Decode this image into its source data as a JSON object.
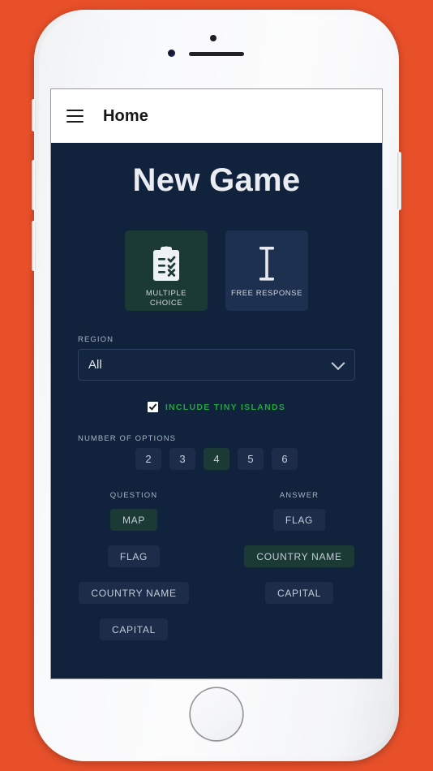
{
  "background_color": "#e8502a",
  "device": {
    "name": "white-smartphone-frame",
    "hardware": {
      "earpiece": "earpiece-speaker",
      "front_camera": "front-camera",
      "proximity_sensor": "proximity-sensor",
      "home_button": "home-button",
      "buttons": [
        "silent-switch",
        "volume-up-button",
        "volume-down-button",
        "power-button"
      ]
    }
  },
  "app_bar": {
    "menu_icon": "hamburger-menu-icon",
    "title": "Home",
    "background": "#ffffff",
    "text_color": "#161618"
  },
  "screen": {
    "background": "#11223d",
    "title": "New Game"
  },
  "mode_cards": [
    {
      "label_line1": "MULTIPLE",
      "label_line2": "CHOICE",
      "icon": "clipboard-checklist-icon",
      "selected": true,
      "color": "#1c3a35"
    },
    {
      "label_line1": "FREE RESPONSE",
      "label_line2": "",
      "icon": "text-cursor-i-beam-icon",
      "selected": false,
      "color": "#1e3050"
    }
  ],
  "region": {
    "label": "REGION",
    "value": "All",
    "chevron_icon": "chevron-down-icon"
  },
  "tiny_islands": {
    "label": "INCLUDE TINY ISLANDS",
    "checked": true,
    "color": "#22a53f",
    "checkbox_icon": "checkbox-checked-icon"
  },
  "number_of_options": {
    "label": "NUMBER OF OPTIONS",
    "options": [
      "2",
      "3",
      "4",
      "5",
      "6"
    ],
    "selected": "4"
  },
  "question_answer": {
    "question": {
      "header": "QUESTION",
      "chips": [
        {
          "label": "MAP",
          "selected": true
        },
        {
          "label": "FLAG",
          "selected": false
        },
        {
          "label": "COUNTRY NAME",
          "selected": false
        },
        {
          "label": "CAPITAL",
          "selected": false
        }
      ]
    },
    "answer": {
      "header": "ANSWER",
      "chips": [
        {
          "label": "FLAG",
          "selected": false
        },
        {
          "label": "COUNTRY NAME",
          "selected": true
        },
        {
          "label": "CAPITAL",
          "selected": false
        }
      ]
    }
  },
  "colors": {
    "selected_chip": "#1c3a35",
    "unselected_chip": "#1c2c49",
    "screen_bg": "#11223d",
    "accent_green": "#22a53f",
    "frame_orange": "#e8502a"
  }
}
